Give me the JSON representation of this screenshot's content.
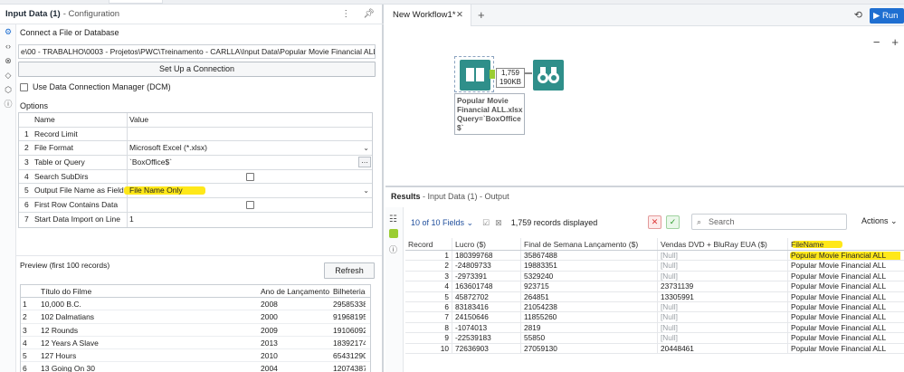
{
  "left_panel": {
    "title": "Input Data (1)",
    "subtitle": "- Configuration",
    "connect_label": "Connect a File or Database",
    "path": "e\\00 - TRABALHO\\0003 - Projetos\\PWC\\Treinamento - CARLLA\\Input Data\\Popular Movie Financial ALL.xlsx",
    "setup_button": "Set Up a Connection",
    "dcm_label": "Use Data Connection Manager (DCM)",
    "options_label": "Options",
    "options_header": {
      "name": "Name",
      "value": "Value"
    },
    "options": [
      {
        "num": "1",
        "name": "Record Limit",
        "value": ""
      },
      {
        "num": "2",
        "name": "File Format",
        "value": "Microsoft Excel (*.xlsx)"
      },
      {
        "num": "3",
        "name": "Table or Query",
        "value": "`BoxOffice$`"
      },
      {
        "num": "4",
        "name": "Search SubDirs",
        "value": ""
      },
      {
        "num": "5",
        "name": "Output File Name as Field",
        "value": "File Name Only"
      },
      {
        "num": "6",
        "name": "First Row Contains Data",
        "value": ""
      },
      {
        "num": "7",
        "name": "Start Data Import on Line",
        "value": "1"
      }
    ],
    "preview_label": "Preview (first 100 records)",
    "refresh_button": "Refresh",
    "preview_headers": [
      "",
      "Título do Filme",
      "Ano de Lançamento",
      "Bilheteria"
    ],
    "preview_rows": [
      [
        "1",
        "10,000 B.C.",
        "2008",
        "29585338"
      ],
      [
        "2",
        "102 Dalmatians",
        "2000",
        "91968195"
      ],
      [
        "3",
        "12 Rounds",
        "2009",
        "19106092"
      ],
      [
        "4",
        "12 Years A Slave",
        "2013",
        "18392174"
      ],
      [
        "5",
        "127 Hours",
        "2010",
        "65431290"
      ],
      [
        "6",
        "13 Going On 30",
        "2004",
        "12074387"
      ]
    ]
  },
  "workflow": {
    "tab_label": "New Workflow1*",
    "run_label": "Run",
    "tool_caption_lines": [
      "Popular Movie",
      "Financial ALL.xlsx",
      "Query=`BoxOffice",
      "$`"
    ],
    "connector_count": "1,759",
    "connector_size": "190KB",
    "colors": {
      "input_tool": "#2f8f8a",
      "browse_tool": "#2f8f8a",
      "run": "#1f6fd1"
    }
  },
  "results": {
    "title": "Results",
    "subtitle": "- Input Data (1) - Output",
    "fields_label": "10 of 10 Fields",
    "records_label": "1,759 records displayed",
    "search_placeholder": "Search",
    "actions_label": "Actions",
    "more_label": "000",
    "headers": [
      "Record",
      "Lucro ($)",
      "Final de Semana Lançamento ($)",
      "Vendas DVD + BluRay EUA ($)",
      "FileName"
    ],
    "rows": [
      [
        "1",
        "180399768",
        "35867488",
        "[Null]",
        "Popular Movie Financial ALL"
      ],
      [
        "2",
        "-24809733",
        "19883351",
        "[Null]",
        "Popular Movie Financial ALL"
      ],
      [
        "3",
        "-2973391",
        "5329240",
        "[Null]",
        "Popular Movie Financial ALL"
      ],
      [
        "4",
        "163601748",
        "923715",
        "23731139",
        "Popular Movie Financial ALL"
      ],
      [
        "5",
        "45872702",
        "264851",
        "13305991",
        "Popular Movie Financial ALL"
      ],
      [
        "6",
        "83183416",
        "21054238",
        "[Null]",
        "Popular Movie Financial ALL"
      ],
      [
        "7",
        "24150646",
        "11855260",
        "[Null]",
        "Popular Movie Financial ALL"
      ],
      [
        "8",
        "-1074013",
        "2819",
        "[Null]",
        "Popular Movie Financial ALL"
      ],
      [
        "9",
        "-22539183",
        "55850",
        "[Null]",
        "Popular Movie Financial ALL"
      ],
      [
        "10",
        "72636903",
        "27059130",
        "20448461",
        "Popular Movie Financial ALL"
      ]
    ]
  },
  "highlight_color": "#ffe600"
}
